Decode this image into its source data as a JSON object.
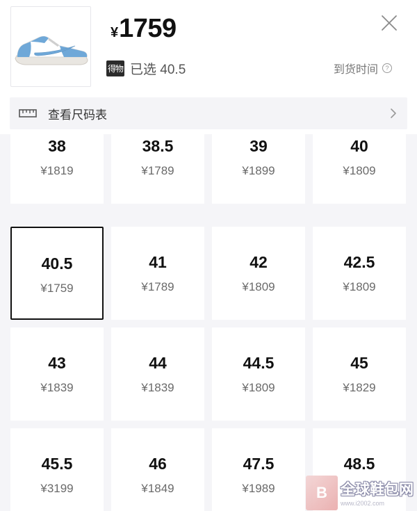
{
  "header": {
    "currency": "¥",
    "price": "1759",
    "badge": "得物",
    "selected_label": "已选 40.5",
    "arrival_label": "到货时间",
    "help_glyph": "?"
  },
  "size_chart": {
    "label": "查看尺码表"
  },
  "sizes": [
    {
      "size": "38",
      "price": "¥1819"
    },
    {
      "size": "38.5",
      "price": "¥1789"
    },
    {
      "size": "39",
      "price": "¥1899"
    },
    {
      "size": "40",
      "price": "¥1809"
    },
    {
      "size": "40.5",
      "price": "¥1759",
      "selected": true
    },
    {
      "size": "41",
      "price": "¥1789"
    },
    {
      "size": "42",
      "price": "¥1809"
    },
    {
      "size": "42.5",
      "price": "¥1809"
    },
    {
      "size": "43",
      "price": "¥1839"
    },
    {
      "size": "44",
      "price": "¥1839"
    },
    {
      "size": "44.5",
      "price": "¥1809"
    },
    {
      "size": "45",
      "price": "¥1829"
    },
    {
      "size": "45.5",
      "price": "¥3199"
    },
    {
      "size": "46",
      "price": "¥1849"
    },
    {
      "size": "47.5",
      "price": "¥1989"
    },
    {
      "size": "48.5",
      "price": ""
    }
  ],
  "watermark": {
    "text": "全球鞋包网",
    "sub": "www.i2002.com",
    "logo_glyph": "B"
  },
  "colors": {
    "shoe_blue": "#6fa8d8",
    "selected_border": "#111111",
    "grid_bg": "#f5f5f8"
  },
  "icons": {
    "close": "close-icon",
    "ruler": "ruler-icon",
    "chevron": "chevron-right-icon",
    "help": "help-circle-icon"
  }
}
